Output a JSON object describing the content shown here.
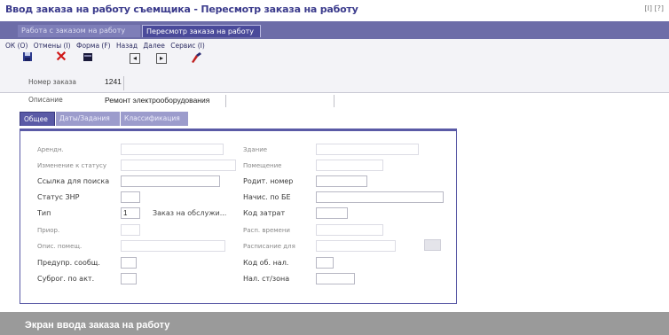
{
  "window": {
    "title": "Ввод заказа на работу съемщика - Пересмотр заказа на работу",
    "controls": "[I] [?]"
  },
  "top_tabs": [
    {
      "label": "Работа с заказом на работу",
      "active": false
    },
    {
      "label": "Пересмотр заказа на работу",
      "active": true
    }
  ],
  "menu": [
    "ОК (О)",
    "Отмены (I)",
    "Форма (F)",
    "Назад",
    "Далее",
    "Сервис (I)"
  ],
  "toolbar_icons": [
    "save-icon",
    "delete-icon",
    "form-icon",
    "prev-icon",
    "next-icon",
    "tools-icon"
  ],
  "header": {
    "order_number_label": "Номер заказа",
    "order_number_value": "1241",
    "description_label": "Описание",
    "description_value": "Ремонт электрооборудования"
  },
  "form_tabs": [
    {
      "label": "Общее",
      "active": true
    },
    {
      "label": "Даты/Задания",
      "active": false
    },
    {
      "label": "Классификация",
      "active": false
    }
  ],
  "form": {
    "left": [
      {
        "label": "Арендн.",
        "value": "",
        "dim": true
      },
      {
        "label": "Изменение к статусу",
        "value": "",
        "dim": true
      },
      {
        "label": "Ссылка для поиска",
        "value": "",
        "dim": false
      },
      {
        "label": "Статус ЗНР",
        "value": "",
        "dim": false
      },
      {
        "label": "Тип",
        "value": "1",
        "dim": false,
        "extra": "Заказ на обслужи..."
      },
      {
        "label": "Приор.",
        "value": "",
        "dim": true
      },
      {
        "label": "Опис. помещ.",
        "value": "",
        "dim": true
      },
      {
        "label": "Предупр. сообщ.",
        "value": "",
        "dim": false
      },
      {
        "label": "Суброг. по акт.",
        "value": "",
        "dim": false
      }
    ],
    "right": [
      {
        "label": "Здание",
        "value": "",
        "dim": true
      },
      {
        "label": "Помещение",
        "value": "",
        "dim": true
      },
      {
        "label": "Родит. номер",
        "value": "",
        "dim": false
      },
      {
        "label": "Начис. по БЕ",
        "value": "",
        "dim": false
      },
      {
        "label": "Код затрат",
        "value": "",
        "dim": false
      },
      {
        "label": "Расп. времени",
        "value": "",
        "dim": true
      },
      {
        "label": "Расписание для",
        "value": "",
        "dim": true
      },
      {
        "label": "Код об. нал.",
        "value": "",
        "dim": false
      },
      {
        "label": "Нал. ст/зона",
        "value": "",
        "dim": false
      }
    ]
  },
  "caption": "Экран ввода заказа на работу",
  "colors": {
    "accent": "#5a5aa6",
    "tab_bar": "#6d6da8",
    "title": "#3b3b8c",
    "caption_bg": "#9a9a9a"
  }
}
